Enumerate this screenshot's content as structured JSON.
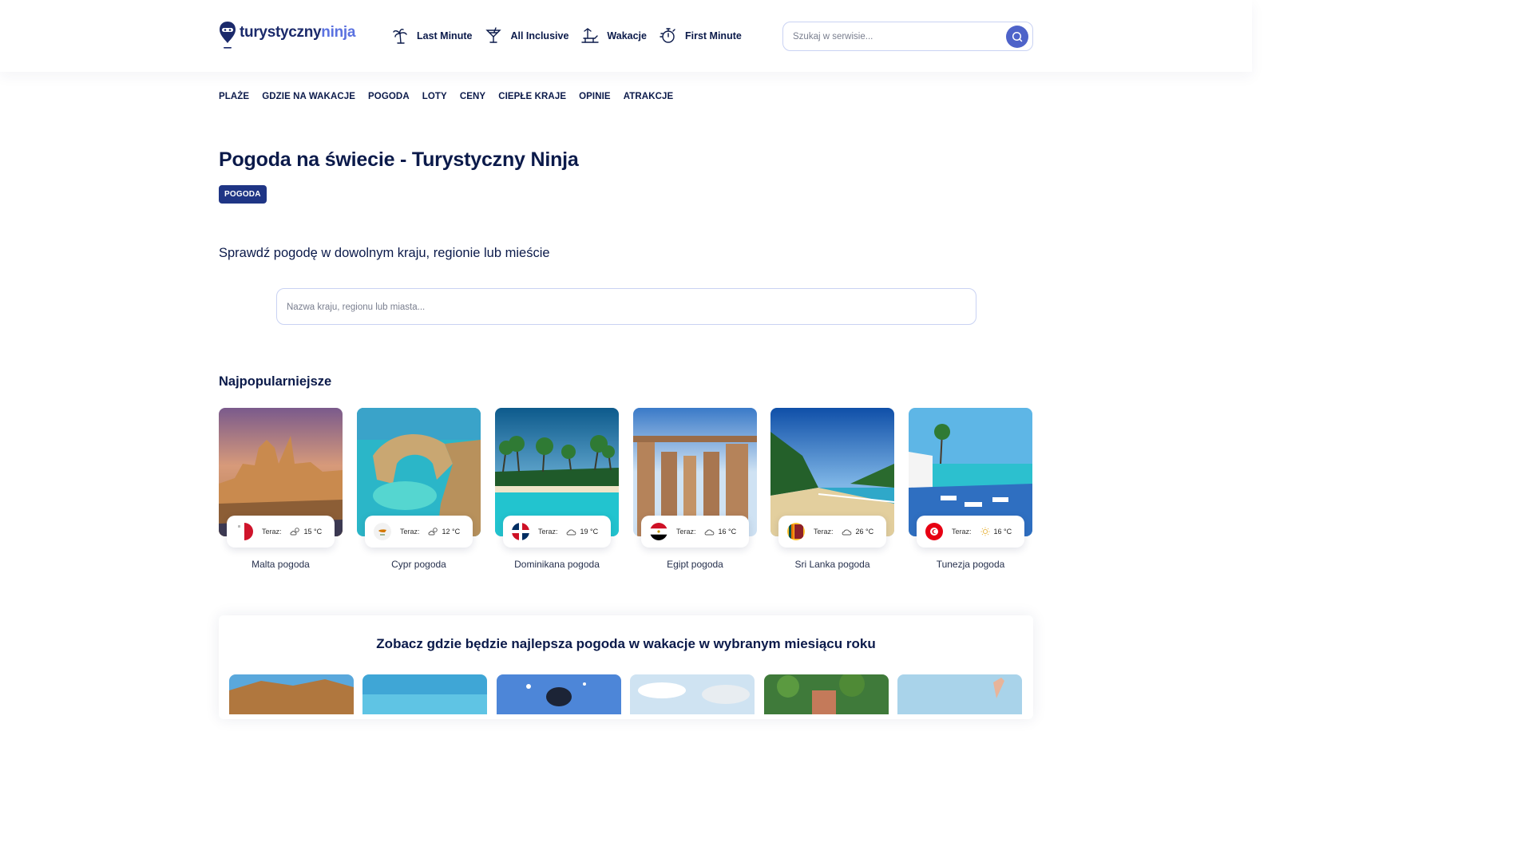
{
  "header": {
    "logo": {
      "part1": "turystyczny",
      "part2": "ninja"
    },
    "nav": [
      {
        "label": "Last Minute",
        "icon": "palm-tree-icon"
      },
      {
        "label": "All Inclusive",
        "icon": "cocktail-icon"
      },
      {
        "label": "Wakacje",
        "icon": "beach-chair-icon"
      },
      {
        "label": "First Minute",
        "icon": "stopwatch-icon"
      }
    ],
    "search": {
      "placeholder": "Szukaj w serwisie..."
    }
  },
  "subnav": [
    "PLAŻE",
    "GDZIE NA WAKACJE",
    "POGODA",
    "LOTY",
    "CENY",
    "CIEPŁE KRAJE",
    "OPINIE",
    "ATRAKCJE"
  ],
  "page": {
    "title": "Pogoda na świecie - Turystyczny Ninja",
    "tag": "POGODA",
    "intro": "Sprawdź pogodę w dowolnym kraju, regionie lub mieście",
    "search_placeholder": "Nazwa kraju, regionu lub miasta..."
  },
  "popular": {
    "title": "Najpopularniejsze",
    "now_label": "Teraz:",
    "items": [
      {
        "name": "Malta pogoda",
        "temp": "15 °C",
        "weather": "partly-cloudy-icon",
        "flag": "malta-flag-icon"
      },
      {
        "name": "Cypr pogoda",
        "temp": "12 °C",
        "weather": "partly-cloudy-icon",
        "flag": "cyprus-flag-icon"
      },
      {
        "name": "Dominikana pogoda",
        "temp": "19 °C",
        "weather": "cloudy-icon",
        "flag": "dominican-republic-flag-icon"
      },
      {
        "name": "Egipt pogoda",
        "temp": "16 °C",
        "weather": "cloudy-icon",
        "flag": "egypt-flag-icon"
      },
      {
        "name": "Sri Lanka pogoda",
        "temp": "26 °C",
        "weather": "cloudy-icon",
        "flag": "sri-lanka-flag-icon"
      },
      {
        "name": "Tunezja pogoda",
        "temp": "16 °C",
        "weather": "sunny-icon",
        "flag": "tunisia-flag-icon"
      }
    ]
  },
  "months": {
    "title": "Zobacz gdzie będzie najlepsza pogoda w wakacje w wybranym miesiącu roku"
  },
  "colors": {
    "primary_dark": "#0b1a4a",
    "tag_bg": "#1f3585",
    "search_button": "#4e63c9",
    "input_border": "#c9d2f3"
  }
}
